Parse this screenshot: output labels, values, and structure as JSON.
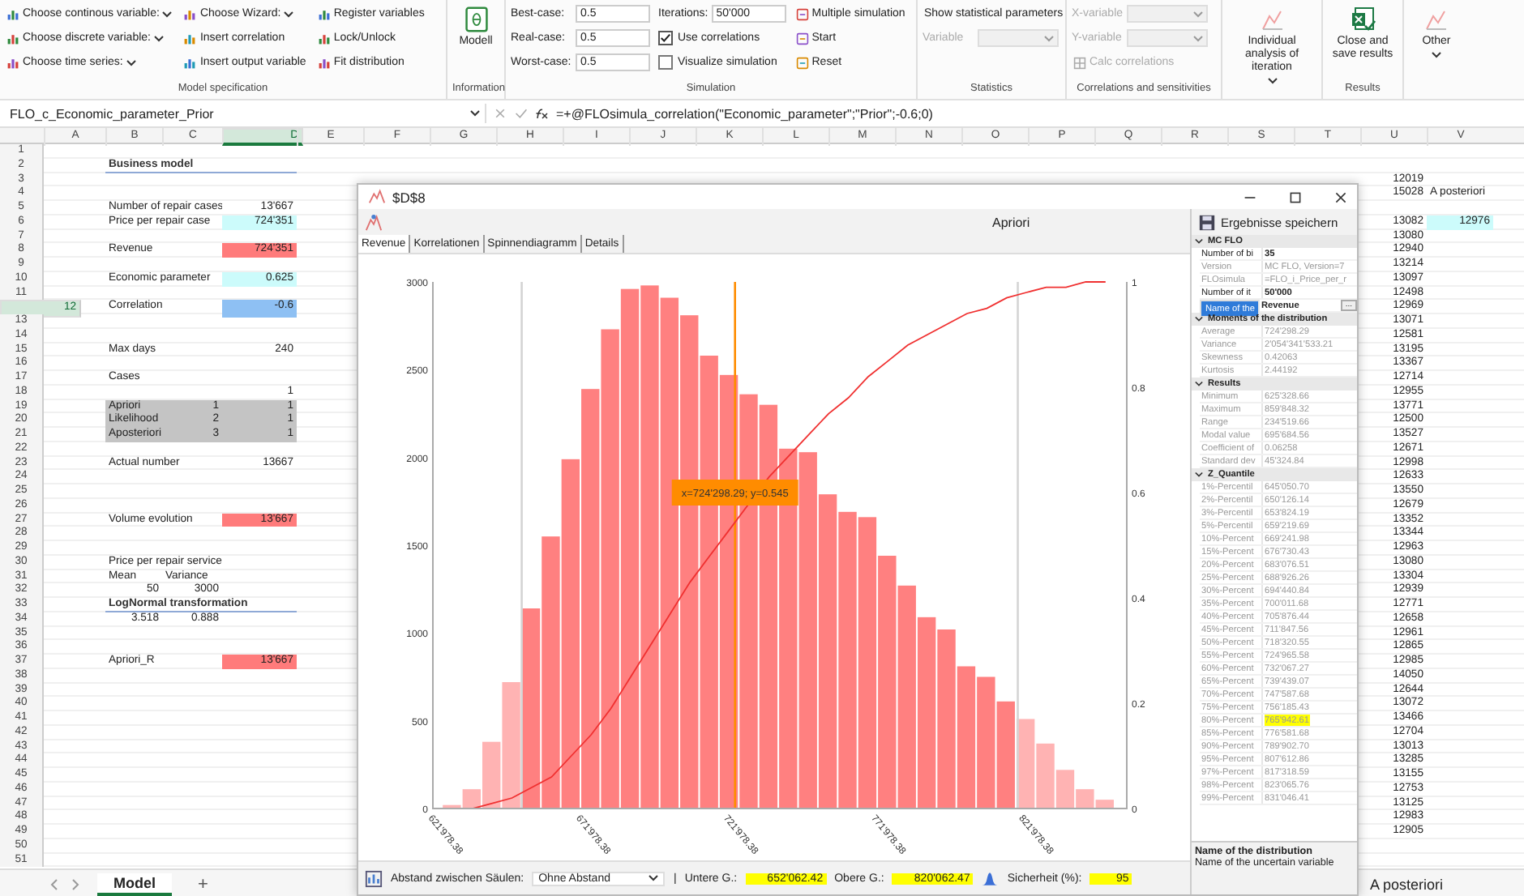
{
  "ribbon": {
    "model_specification": {
      "label": "Model specification",
      "columns": [
        [
          {
            "label": "Choose continous variable:",
            "dropdown": true
          },
          {
            "label": "Choose discrete variable:",
            "dropdown": true
          },
          {
            "label": "Choose time series:",
            "dropdown": true
          }
        ],
        [
          {
            "label": "Choose Wizard:",
            "dropdown": true
          },
          {
            "label": "Insert correlation",
            "dropdown": false
          },
          {
            "label": "Insert output variable",
            "dropdown": false
          }
        ],
        [
          {
            "label": "Register variables",
            "dropdown": false
          },
          {
            "label": "Lock/Unlock",
            "dropdown": false
          },
          {
            "label": "Fit distribution",
            "dropdown": false
          }
        ]
      ]
    },
    "information": {
      "label": "Information",
      "button": "Modell"
    },
    "simulation": {
      "label": "Simulation",
      "fields": [
        {
          "label": "Best-case:",
          "value": "0.5"
        },
        {
          "label": "Real-case:",
          "value": "0.5"
        },
        {
          "label": "Worst-case:",
          "value": "0.5"
        }
      ],
      "iterations": {
        "label": "Iterations:",
        "value": "50'000"
      },
      "checkboxes": [
        {
          "label": "Use correlations",
          "checked": true
        },
        {
          "label": "Visualize simulation",
          "checked": false
        }
      ],
      "buttons": [
        "Multiple simulation",
        "Start",
        "Reset"
      ]
    },
    "statistics": {
      "label": "Statistics",
      "button": "Show statistical parameters",
      "variable": {
        "label": "Variable",
        "disabled": true
      }
    },
    "correlations": {
      "label": "Correlations and sensitivities",
      "selects": [
        {
          "label": "X-variable",
          "disabled": true
        },
        {
          "label": "Y-variable",
          "disabled": true
        }
      ],
      "calc": {
        "label": "Calc correlations",
        "disabled": true
      }
    },
    "individual": {
      "label": "Individual analysis of iteration",
      "dropdown": true
    },
    "results": {
      "label": "Results",
      "button": "Close and save results"
    },
    "other": {
      "label": "Other",
      "dropdown": true
    }
  },
  "formula_bar": {
    "name_box": "FLO_c_Economic_parameter_Prior",
    "formula": "=+@FLOsimula_correlation(\"Economic_parameter\";\"Prior\";-0.6;0)"
  },
  "sheet": {
    "columns": [
      {
        "label": "A",
        "selected": false
      },
      {
        "label": "B",
        "selected": false
      },
      {
        "label": "C",
        "selected": false
      },
      {
        "label": "D",
        "selected": true
      },
      {
        "label": "E",
        "selected": false
      },
      {
        "label": "F",
        "selected": false
      },
      {
        "label": "G",
        "selected": false
      },
      {
        "label": "H",
        "selected": false
      },
      {
        "label": "I",
        "selected": false
      },
      {
        "label": "J",
        "selected": false
      },
      {
        "label": "K",
        "selected": false
      },
      {
        "label": "L",
        "selected": false
      },
      {
        "label": "M",
        "selected": false
      },
      {
        "label": "N",
        "selected": false
      },
      {
        "label": "O",
        "selected": false
      },
      {
        "label": "P",
        "selected": false
      },
      {
        "label": "Q",
        "selected": false
      },
      {
        "label": "R",
        "selected": false
      },
      {
        "label": "S",
        "selected": false
      },
      {
        "label": "T",
        "selected": false
      },
      {
        "label": "U",
        "selected": false
      },
      {
        "label": "V",
        "selected": false
      }
    ],
    "rows": [
      {
        "number": "1",
        "selected": false,
        "cells": {}
      },
      {
        "number": "2",
        "selected": false,
        "cells": {
          "B": {
            "text": "Business model",
            "kind": "title"
          }
        }
      },
      {
        "number": "3",
        "selected": false,
        "cells": {
          "U": {
            "text": "12019",
            "kind": "number"
          }
        }
      },
      {
        "number": "4",
        "selected": false,
        "cells": {
          "U": {
            "text": "15028",
            "kind": "number"
          },
          "V": {
            "text": "A posteriori",
            "kind": "text"
          }
        }
      },
      {
        "number": "5",
        "selected": false,
        "cells": {
          "B": {
            "text": "Number of repair cases",
            "kind": "text"
          },
          "D": {
            "text": "13'667",
            "kind": "number"
          }
        }
      },
      {
        "number": "6",
        "selected": false,
        "cells": {
          "B": {
            "text": "Price per repair case",
            "kind": "text"
          },
          "D": {
            "text": "724'351",
            "kind": "number",
            "color": "#ccfbfb"
          },
          "U": {
            "text": "13082",
            "kind": "number"
          },
          "V": {
            "text": "12976",
            "kind": "number",
            "color": "#ccfbfb"
          }
        }
      },
      {
        "number": "7",
        "selected": false,
        "cells": {
          "U": {
            "text": "13080",
            "kind": "number"
          }
        }
      },
      {
        "number": "8",
        "selected": false,
        "cells": {
          "B": {
            "text": "Revenue",
            "kind": "text"
          },
          "D": {
            "text": "724'351",
            "kind": "number",
            "color": "#ff7b7b"
          },
          "U": {
            "text": "12940",
            "kind": "number"
          }
        }
      },
      {
        "number": "9",
        "selected": false,
        "cells": {
          "U": {
            "text": "13214",
            "kind": "number"
          }
        }
      },
      {
        "number": "10",
        "selected": false,
        "cells": {
          "B": {
            "text": "Economic parameter",
            "kind": "text"
          },
          "D": {
            "text": "0.625",
            "kind": "number",
            "color": "#ccfbfb"
          },
          "U": {
            "text": "13097",
            "kind": "number"
          }
        }
      },
      {
        "number": "11",
        "selected": false,
        "cells": {
          "U": {
            "text": "12498",
            "kind": "number"
          }
        }
      },
      {
        "number": "12",
        "selected": true,
        "cells": {
          "B": {
            "text": "Correlation",
            "kind": "text"
          },
          "D": {
            "text": "-0.6",
            "kind": "number",
            "color": "#8ec0f3"
          },
          "U": {
            "text": "12969",
            "kind": "number"
          }
        }
      },
      {
        "number": "13",
        "selected": false,
        "cells": {
          "U": {
            "text": "13071",
            "kind": "number"
          }
        }
      },
      {
        "number": "14",
        "selected": false,
        "cells": {
          "U": {
            "text": "12581",
            "kind": "number"
          }
        }
      },
      {
        "number": "15",
        "selected": false,
        "cells": {
          "B": {
            "text": "Max days",
            "kind": "text"
          },
          "D": {
            "text": "240",
            "kind": "number"
          },
          "U": {
            "text": "13195",
            "kind": "number"
          }
        }
      },
      {
        "number": "16",
        "selected": false,
        "cells": {
          "U": {
            "text": "13367",
            "kind": "number"
          }
        }
      },
      {
        "number": "17",
        "selected": false,
        "cells": {
          "B": {
            "text": "Cases",
            "kind": "text"
          },
          "U": {
            "text": "12714",
            "kind": "number"
          }
        }
      },
      {
        "number": "18",
        "selected": false,
        "cells": {
          "D": {
            "text": "1",
            "kind": "number"
          },
          "U": {
            "text": "12955",
            "kind": "number"
          }
        }
      },
      {
        "number": "19",
        "selected": false,
        "cells": {
          "B": {
            "text": "Apriori",
            "kind": "text",
            "color": "#c4c4c4"
          },
          "C": {
            "text": "1",
            "kind": "number",
            "color": "#c4c4c4"
          },
          "D": {
            "text": "1",
            "kind": "number",
            "color": "#c4c4c4"
          },
          "U": {
            "text": "13771",
            "kind": "number"
          }
        }
      },
      {
        "number": "20",
        "selected": false,
        "cells": {
          "B": {
            "text": "Likelihood",
            "kind": "text",
            "color": "#c4c4c4"
          },
          "C": {
            "text": "2",
            "kind": "number",
            "color": "#c4c4c4"
          },
          "D": {
            "text": "1",
            "kind": "number",
            "color": "#c4c4c4"
          },
          "U": {
            "text": "12500",
            "kind": "number"
          }
        }
      },
      {
        "number": "21",
        "selected": false,
        "cells": {
          "B": {
            "text": "Aposteriori",
            "kind": "text",
            "color": "#c4c4c4"
          },
          "C": {
            "text": "3",
            "kind": "number",
            "color": "#c4c4c4"
          },
          "D": {
            "text": "1",
            "kind": "number",
            "color": "#c4c4c4"
          },
          "U": {
            "text": "13527",
            "kind": "number"
          }
        }
      },
      {
        "number": "22",
        "selected": false,
        "cells": {
          "U": {
            "text": "12671",
            "kind": "number"
          }
        }
      },
      {
        "number": "23",
        "selected": false,
        "cells": {
          "B": {
            "text": "Actual number",
            "kind": "text"
          },
          "D": {
            "text": "13667",
            "kind": "number"
          },
          "U": {
            "text": "12998",
            "kind": "number"
          }
        }
      },
      {
        "number": "24",
        "selected": false,
        "cells": {
          "U": {
            "text": "12633",
            "kind": "number"
          }
        }
      },
      {
        "number": "25",
        "selected": false,
        "cells": {
          "U": {
            "text": "13550",
            "kind": "number"
          }
        }
      },
      {
        "number": "26",
        "selected": false,
        "cells": {
          "U": {
            "text": "12679",
            "kind": "number"
          }
        }
      },
      {
        "number": "27",
        "selected": false,
        "cells": {
          "B": {
            "text": "Volume evolution",
            "kind": "text"
          },
          "D": {
            "text": "13'667",
            "kind": "number",
            "color": "#ff7b7b"
          },
          "U": {
            "text": "13352",
            "kind": "number"
          }
        }
      },
      {
        "number": "28",
        "selected": false,
        "cells": {
          "U": {
            "text": "13344",
            "kind": "number"
          }
        }
      },
      {
        "number": "29",
        "selected": false,
        "cells": {
          "U": {
            "text": "12963",
            "kind": "number"
          }
        }
      },
      {
        "number": "30",
        "selected": false,
        "cells": {
          "B": {
            "text": "Price per repair service",
            "kind": "text"
          },
          "U": {
            "text": "13080",
            "kind": "number"
          }
        }
      },
      {
        "number": "31",
        "selected": false,
        "cells": {
          "B": {
            "text": "Mean",
            "kind": "text"
          },
          "C": {
            "text": "Variance",
            "kind": "text"
          },
          "U": {
            "text": "13304",
            "kind": "number"
          }
        }
      },
      {
        "number": "32",
        "selected": false,
        "cells": {
          "B": {
            "text": "50",
            "kind": "number"
          },
          "C": {
            "text": "3000",
            "kind": "number"
          },
          "U": {
            "text": "12939",
            "kind": "number"
          }
        }
      },
      {
        "number": "33",
        "selected": false,
        "cells": {
          "B": {
            "text": "LogNormal transformation",
            "kind": "title"
          },
          "U": {
            "text": "12771",
            "kind": "number"
          }
        }
      },
      {
        "number": "34",
        "selected": false,
        "cells": {
          "B": {
            "text": "3.518",
            "kind": "number"
          },
          "C": {
            "text": "0.888",
            "kind": "number"
          },
          "U": {
            "text": "12658",
            "kind": "number"
          }
        }
      },
      {
        "number": "35",
        "selected": false,
        "cells": {
          "U": {
            "text": "12961",
            "kind": "number"
          }
        }
      },
      {
        "number": "36",
        "selected": false,
        "cells": {
          "U": {
            "text": "12865",
            "kind": "number"
          }
        }
      },
      {
        "number": "37",
        "selected": false,
        "cells": {
          "B": {
            "text": "Apriori_R",
            "kind": "text"
          },
          "D": {
            "text": "13'667",
            "kind": "number",
            "color": "#ff7b7b"
          },
          "U": {
            "text": "12985",
            "kind": "number"
          }
        }
      },
      {
        "number": "38",
        "selected": false,
        "cells": {
          "U": {
            "text": "14050",
            "kind": "number"
          }
        }
      },
      {
        "number": "39",
        "selected": false,
        "cells": {
          "U": {
            "text": "12644",
            "kind": "number"
          }
        }
      },
      {
        "number": "40",
        "selected": false,
        "cells": {
          "U": {
            "text": "13072",
            "kind": "number"
          }
        }
      },
      {
        "number": "41",
        "selected": false,
        "cells": {
          "U": {
            "text": "13466",
            "kind": "number"
          }
        }
      },
      {
        "number": "42",
        "selected": false,
        "cells": {
          "U": {
            "text": "12704",
            "kind": "number"
          }
        }
      },
      {
        "number": "43",
        "selected": false,
        "cells": {
          "U": {
            "text": "13013",
            "kind": "number"
          }
        }
      },
      {
        "number": "44",
        "selected": false,
        "cells": {
          "U": {
            "text": "13285",
            "kind": "number"
          }
        }
      },
      {
        "number": "45",
        "selected": false,
        "cells": {
          "U": {
            "text": "13155",
            "kind": "number"
          }
        }
      },
      {
        "number": "46",
        "selected": false,
        "cells": {
          "U": {
            "text": "12753",
            "kind": "number"
          }
        }
      },
      {
        "number": "47",
        "selected": false,
        "cells": {
          "U": {
            "text": "13125",
            "kind": "number"
          }
        }
      },
      {
        "number": "48",
        "selected": false,
        "cells": {
          "U": {
            "text": "12983",
            "kind": "number"
          }
        }
      },
      {
        "number": "49",
        "selected": false,
        "cells": {
          "U": {
            "text": "12905",
            "kind": "number"
          }
        }
      },
      {
        "number": "50",
        "selected": false,
        "cells": {}
      },
      {
        "number": "51",
        "selected": false,
        "cells": {}
      }
    ]
  },
  "sheet_tabs": [
    {
      "label": "Model",
      "selected": true
    },
    {
      "label": "A posteriori",
      "selected": false
    }
  ],
  "add_sheet": "+",
  "chart_window": {
    "title": "$D$8",
    "label": "Apriori",
    "tabs": [
      {
        "label": "Revenue",
        "selected": true
      },
      {
        "label": "Korrelationen",
        "selected": false
      },
      {
        "label": "Spinnendiagramm",
        "selected": false
      },
      {
        "label": "Details",
        "selected": false
      }
    ],
    "chart_data": {
      "type": "bar",
      "x": [
        628679,
        635379,
        642079,
        648779,
        655479,
        662179,
        668879,
        675579,
        682279,
        688979,
        695679,
        702379,
        709079,
        715779,
        722479,
        729179,
        735879,
        742579,
        749279,
        755979,
        762679,
        769379,
        776079,
        782779,
        789479,
        796179,
        802879,
        809579,
        816279,
        822979,
        829679,
        836379,
        843079,
        849779
      ],
      "series": [
        {
          "color": "#ffb3b3",
          "values": [
            20,
            110,
            380,
            720,
            null,
            null,
            null,
            null,
            null,
            null,
            null,
            null,
            null,
            null,
            null,
            null,
            null,
            null,
            null,
            null,
            null,
            null,
            null,
            null,
            null,
            null,
            null,
            null,
            null,
            510,
            370,
            220,
            110,
            50
          ]
        },
        {
          "color": "#ff8080",
          "values": [
            null,
            null,
            null,
            null,
            1140,
            1550,
            1990,
            2390,
            2730,
            2960,
            2980,
            2910,
            2810,
            2580,
            2470,
            2360,
            2300,
            2050,
            2030,
            1790,
            1690,
            1660,
            1440,
            1270,
            1090,
            1020,
            810,
            750,
            610,
            null,
            null,
            null,
            null,
            null
          ]
        },
        {
          "color": "#f03030",
          "type": "line",
          "axis": "y2",
          "values": [
            0,
            0,
            0.01,
            0.02,
            0.04,
            0.06,
            0.1,
            0.14,
            0.19,
            0.25,
            0.31,
            0.37,
            0.43,
            0.48,
            0.53,
            0.58,
            0.63,
            0.67,
            0.71,
            0.75,
            0.78,
            0.82,
            0.85,
            0.88,
            0.9,
            0.92,
            0.94,
            0.95,
            0.97,
            0.98,
            0.99,
            0.99,
            1,
            1
          ]
        }
      ],
      "xlim": [
        621978.38,
        856978.38
      ],
      "ylim": [
        0,
        3000
      ],
      "y2lim": [
        0,
        1
      ],
      "xticks": [
        {
          "value": 621978.38,
          "label": "621'978.38"
        },
        {
          "value": 671978.38,
          "label": "671'978.38"
        },
        {
          "value": 721978.38,
          "label": "721'978.38"
        },
        {
          "value": 771978.38,
          "label": "771'978.38"
        },
        {
          "value": 821978.38,
          "label": "821'978.38"
        }
      ],
      "yticks": [
        0,
        500,
        1000,
        1500,
        2000,
        2500,
        3000
      ],
      "y2ticks": [
        {
          "value": 0,
          "label": "0"
        },
        {
          "value": 0.2,
          "label": "0.2"
        },
        {
          "value": 0.4,
          "label": "0.4"
        },
        {
          "value": 0.6,
          "label": "0.6"
        },
        {
          "value": 0.8,
          "label": "0.8"
        },
        {
          "value": 1,
          "label": "1"
        }
      ],
      "ref_lines": [
        {
          "axis": "x",
          "value": 652062.42,
          "color": "#d4d4d4"
        },
        {
          "axis": "x",
          "value": 820062.47,
          "color": "#d4d4d4"
        },
        {
          "axis": "x",
          "value": 724298.29,
          "color": "#ff8c00"
        }
      ],
      "annotations": [
        {
          "x": 724298.29,
          "y": 1800,
          "text": "x=724'298.29; y=0.545"
        }
      ]
    },
    "bottom_bar": {
      "spacing_label": "Abstand zwischen Säulen:",
      "spacing_value": "Ohne Abstand",
      "separator": "|",
      "fields": [
        {
          "label": "Untere G.:",
          "value": "652'062.42",
          "highlighted": true
        },
        {
          "label": "Obere G.:",
          "value": "820'062.47",
          "highlighted": true
        }
      ],
      "confidence": {
        "label": "Sicherheit (%):",
        "value": "95",
        "highlighted": true
      }
    },
    "panel": {
      "save_button": "Ergebnisse speichern",
      "sections": [
        {
          "title": "MC FLO",
          "rows": [
            {
              "name": "Number of bi",
              "value": "35",
              "readonly": false,
              "selected": false,
              "highlighted": false
            },
            {
              "name": "Version",
              "value": "MC FLO, Version=7",
              "readonly": true,
              "selected": false,
              "highlighted": false
            },
            {
              "name": "FLOsimula",
              "value": "=FLO_i_Price_per_r",
              "readonly": true,
              "selected": false,
              "highlighted": false
            },
            {
              "name": "Number of it",
              "value": "50'000",
              "readonly": false,
              "selected": false,
              "highlighted": false
            },
            {
              "name": "Name of the",
              "value": "Revenue",
              "readonly": false,
              "selected": true,
              "highlighted": false,
              "button": "..."
            }
          ]
        },
        {
          "title": "Moments of the distribution",
          "rows": [
            {
              "name": "Average",
              "value": "724'298.29",
              "readonly": true,
              "selected": false,
              "highlighted": false
            },
            {
              "name": "Variance",
              "value": "2'054'341'533.21",
              "readonly": true,
              "selected": false,
              "highlighted": false
            },
            {
              "name": "Skewness",
              "value": "0.42063",
              "readonly": true,
              "selected": false,
              "highlighted": false
            },
            {
              "name": "Kurtosis",
              "value": "2.44192",
              "readonly": true,
              "selected": false,
              "highlighted": false
            }
          ]
        },
        {
          "title": "Results",
          "rows": [
            {
              "name": "Minimum",
              "value": "625'328.66",
              "readonly": true,
              "selected": false,
              "highlighted": false
            },
            {
              "name": "Maximum",
              "value": "859'848.32",
              "readonly": true,
              "selected": false,
              "highlighted": false
            },
            {
              "name": "Range",
              "value": "234'519.66",
              "readonly": true,
              "selected": false,
              "highlighted": false
            },
            {
              "name": "Modal value",
              "value": "695'684.56",
              "readonly": true,
              "selected": false,
              "highlighted": false
            },
            {
              "name": "Coefficient of",
              "value": "0.06258",
              "readonly": true,
              "selected": false,
              "highlighted": false
            },
            {
              "name": "Standard dev",
              "value": "45'324.84",
              "readonly": true,
              "selected": false,
              "highlighted": false
            }
          ]
        },
        {
          "title": "Z_Quantile",
          "rows": [
            {
              "name": "1%-Percentil",
              "value": "645'050.70",
              "readonly": true,
              "selected": false,
              "highlighted": false
            },
            {
              "name": "2%-Percentil",
              "value": "650'126.14",
              "readonly": true,
              "selected": false,
              "highlighted": false
            },
            {
              "name": "3%-Percentil",
              "value": "653'824.19",
              "readonly": true,
              "selected": false,
              "highlighted": false
            },
            {
              "name": "5%-Percentil",
              "value": "659'219.69",
              "readonly": true,
              "selected": false,
              "highlighted": false
            },
            {
              "name": "10%-Percent",
              "value": "669'241.98",
              "readonly": true,
              "selected": false,
              "highlighted": false
            },
            {
              "name": "15%-Percent",
              "value": "676'730.43",
              "readonly": true,
              "selected": false,
              "highlighted": false
            },
            {
              "name": "20%-Percent",
              "value": "683'076.51",
              "readonly": true,
              "selected": false,
              "highlighted": false
            },
            {
              "name": "25%-Percent",
              "value": "688'926.26",
              "readonly": true,
              "selected": false,
              "highlighted": false
            },
            {
              "name": "30%-Percent",
              "value": "694'440.84",
              "readonly": true,
              "selected": false,
              "highlighted": false
            },
            {
              "name": "35%-Percent",
              "value": "700'011.68",
              "readonly": true,
              "selected": false,
              "highlighted": false
            },
            {
              "name": "40%-Percent",
              "value": "705'876.44",
              "readonly": true,
              "selected": false,
              "highlighted": false
            },
            {
              "name": "45%-Percent",
              "value": "711'847.56",
              "readonly": true,
              "selected": false,
              "highlighted": false
            },
            {
              "name": "50%-Percent",
              "value": "718'320.55",
              "readonly": true,
              "selected": false,
              "highlighted": false
            },
            {
              "name": "55%-Percent",
              "value": "724'965.58",
              "readonly": true,
              "selected": false,
              "highlighted": false
            },
            {
              "name": "60%-Percent",
              "value": "732'067.27",
              "readonly": true,
              "selected": false,
              "highlighted": false
            },
            {
              "name": "65%-Percent",
              "value": "739'439.07",
              "readonly": true,
              "selected": false,
              "highlighted": false
            },
            {
              "name": "70%-Percent",
              "value": "747'587.68",
              "readonly": true,
              "selected": false,
              "highlighted": false
            },
            {
              "name": "75%-Percent",
              "value": "756'185.43",
              "readonly": true,
              "selected": false,
              "highlighted": false
            },
            {
              "name": "80%-Percent",
              "value": "765'942.61",
              "readonly": true,
              "selected": false,
              "highlighted": true
            },
            {
              "name": "85%-Percent",
              "value": "776'581.68",
              "readonly": true,
              "selected": false,
              "highlighted": false
            },
            {
              "name": "90%-Percent",
              "value": "789'902.70",
              "readonly": true,
              "selected": false,
              "highlighted": false
            },
            {
              "name": "95%-Percent",
              "value": "807'612.86",
              "readonly": true,
              "selected": false,
              "highlighted": false
            },
            {
              "name": "97%-Percent",
              "value": "817'318.59",
              "readonly": true,
              "selected": false,
              "highlighted": false
            },
            {
              "name": "98%-Percent",
              "value": "823'065.76",
              "readonly": true,
              "selected": false,
              "highlighted": false
            },
            {
              "name": "99%-Percent",
              "value": "831'046.41",
              "readonly": true,
              "selected": false,
              "highlighted": false
            }
          ]
        }
      ],
      "description": {
        "title": "Name of the distribution",
        "text": "Name of the uncertain variable"
      }
    }
  }
}
